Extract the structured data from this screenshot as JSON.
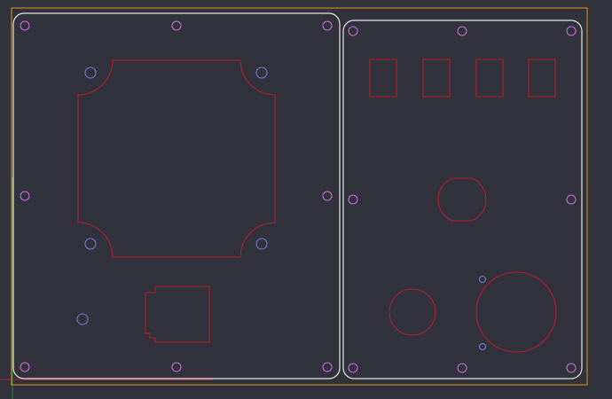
{
  "viewport": {
    "background": "#32323c"
  },
  "colors": {
    "board_frame": "#e0951c",
    "panel_outline": "#e6e6e6",
    "cutout": "#b0202a",
    "mount_hole": "#c86ed2",
    "mount_hole_blue": "#7a78d8",
    "axis_x": "#b0202a",
    "axis_y": "#2a8a3a"
  },
  "icons": {
    "axis_origin": "origin-axes-icon",
    "mount_hole": "mounting-hole-icon"
  }
}
